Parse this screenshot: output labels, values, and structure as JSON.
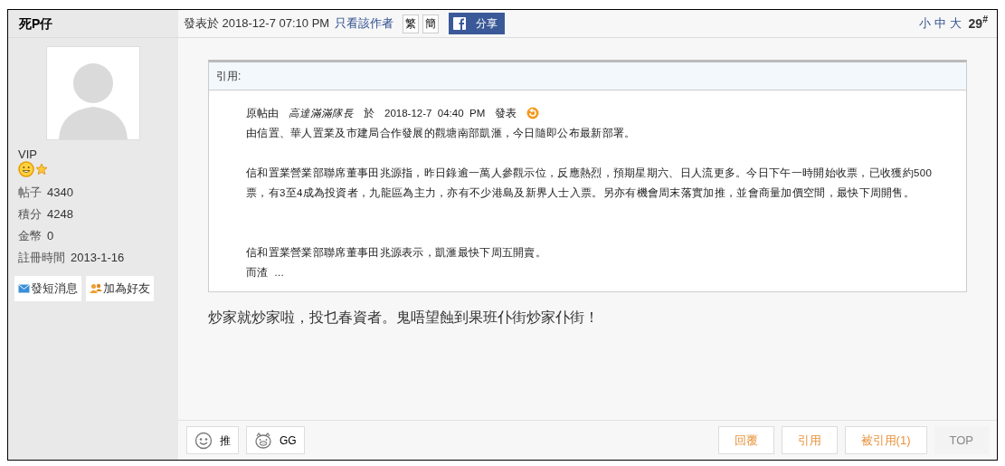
{
  "author": {
    "name": "死P仔",
    "group": "VIP",
    "stats": [
      {
        "label": "帖子",
        "value": "4340"
      },
      {
        "label": "積分",
        "value": "4248"
      },
      {
        "label": "金幣",
        "value": "0"
      },
      {
        "label": "註冊時間",
        "value": "2013-1-16"
      }
    ],
    "actions": [
      {
        "kind": "message",
        "label": "發短消息"
      },
      {
        "kind": "friend",
        "label": "加為好友"
      }
    ]
  },
  "post": {
    "posted": "發表於 2018-12-7 07:10 PM",
    "author_only": "只看該作者",
    "script_buttons": [
      "繁",
      "簡"
    ],
    "share": "分享",
    "font_sizes": [
      "小",
      "中",
      "大"
    ],
    "floor": "29$^{#}$",
    "quote": {
      "title": "引用:",
      "byline": {
        "prefix": "原帖由",
        "author": "高達滿滿隊長",
        "on": "於",
        "time": "2018-12-7  04:40  PM",
        "suffix": "發表"
      },
      "paragraphs": [
        "由信置、華人置業及市建局合作發展的觀塘南部凱滙，今日隨即公布最新部署。",
        "信和置業營業部聯席董事田兆源指，昨日錄逾一萬人參觀示位，反應熱烈，預期星期六、日人流更多。今日下午一時開始收票，已收獲約500票，有3至4成為投資者，九龍區為主力，亦有不少港島及新界人士入票。另亦有機會周末落實加推，並會商量加價空間，最快下周開售。",
        "信和置業營業部聯席董事田兆源表示，凱滙最快下周五開賣。",
        "而渣  ..."
      ]
    },
    "message": "炒家就炒家啦，投乜春資者。鬼唔望蝕到果班仆街炒家仆街！",
    "reactions": [
      {
        "kind": "smile",
        "label": "推"
      },
      {
        "kind": "pig",
        "label": "GG"
      }
    ],
    "footer_buttons": [
      {
        "label": "回覆",
        "kind": "action"
      },
      {
        "label": "引用",
        "kind": "action"
      },
      {
        "label": "被引用(1)",
        "kind": "action"
      },
      {
        "label": "TOP",
        "kind": "plain"
      }
    ]
  }
}
